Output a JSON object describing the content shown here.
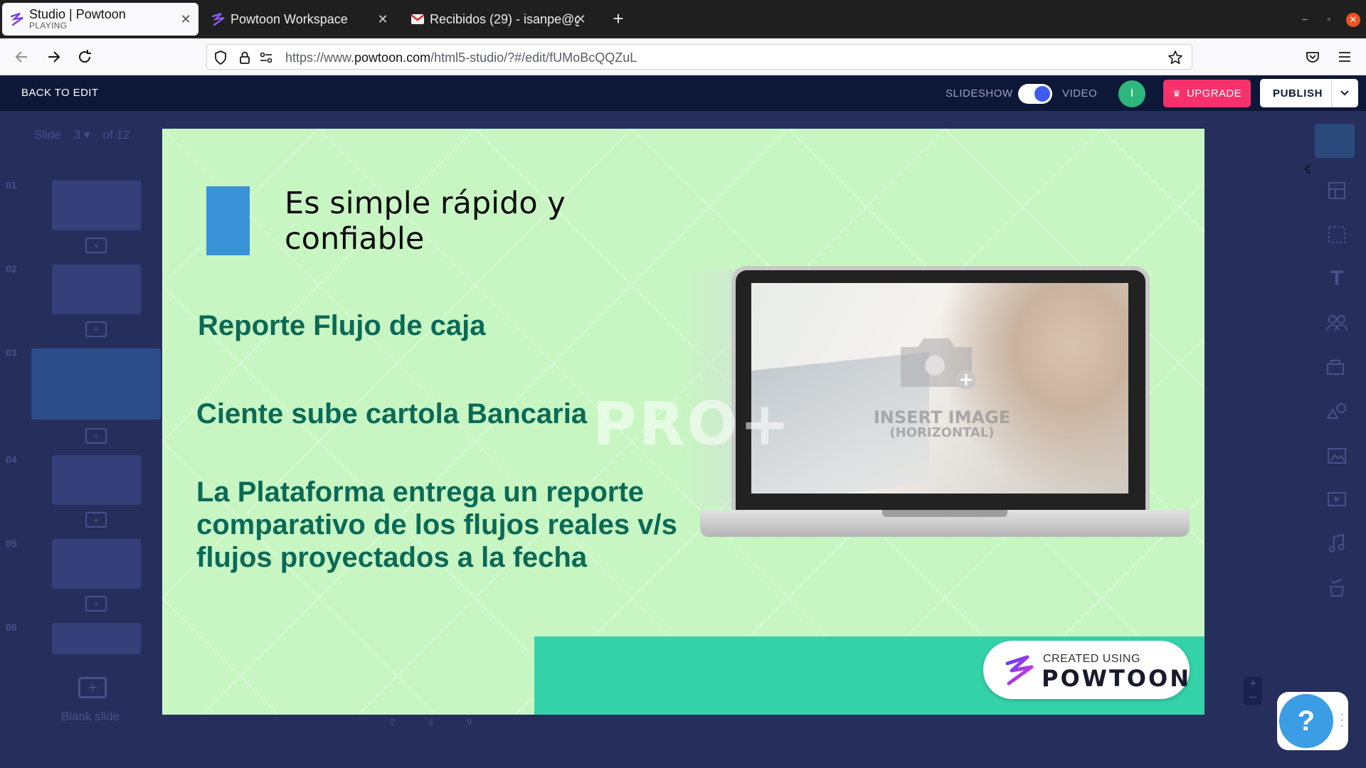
{
  "browser": {
    "tabs": [
      {
        "title": "Studio | Powtoon",
        "subtitle": "PLAYING",
        "active": true
      },
      {
        "title": "Powtoon Workspace",
        "active": false
      },
      {
        "title": "Recibidos (29) - isanpe@g",
        "active": false
      }
    ],
    "url_prefix": "https://www.",
    "url_domain": "powtoon.com",
    "url_path": "/html5-studio/?#/edit/fUMoBcQQZuL"
  },
  "topbar": {
    "back_label": "BACK TO EDIT",
    "mode_left": "SLIDESHOW",
    "mode_right": "VIDEO",
    "avatar_initial": "I",
    "upgrade_label": "UPGRADE",
    "publish_label": "PUBLISH"
  },
  "editor": {
    "slide_label": "Slide",
    "slide_current": "3",
    "slide_total": "of 12",
    "thumb_numbers": [
      "01",
      "02",
      "03",
      "04",
      "05",
      "06"
    ],
    "blank_slide_label": "Blank slide",
    "timeline_numbers": [
      "2",
      "4",
      "9"
    ]
  },
  "slide": {
    "title": "Es simple rápido y confiable",
    "bullets": [
      "Reporte Flujo de caja",
      "Ciente sube cartola Bancaria",
      "La Plataforma entrega un reporte comparativo de los flujos reales v/s flujos proyectados a la fecha"
    ],
    "watermark": "PRO+",
    "placeholder_main": "INSERT IMAGE",
    "placeholder_sub": "(HORIZONTAL)",
    "badge_small": "CREATED USING",
    "badge_big": "POWTOON"
  },
  "colors": {
    "slide_bg": "#c8f6c3",
    "bullet_text": "#0a6a56",
    "accent_square": "#3a92d8",
    "teal_band": "#34d2a9",
    "upgrade_bg": "#f8316c",
    "topbar_bg": "#0d1738",
    "toggle_knob": "#3e5cf0",
    "avatar_bg": "#2eb67d",
    "help_bg": "#3b9de3"
  },
  "icons": [
    "powtoon-logo-icon",
    "gmail-icon",
    "back-icon",
    "forward-icon",
    "reload-icon",
    "shield-icon",
    "lock-icon",
    "permissions-icon",
    "star-icon",
    "pocket-icon",
    "menu-icon",
    "crown-icon",
    "chevron-down-icon",
    "chevron-left-icon",
    "help-icon"
  ]
}
